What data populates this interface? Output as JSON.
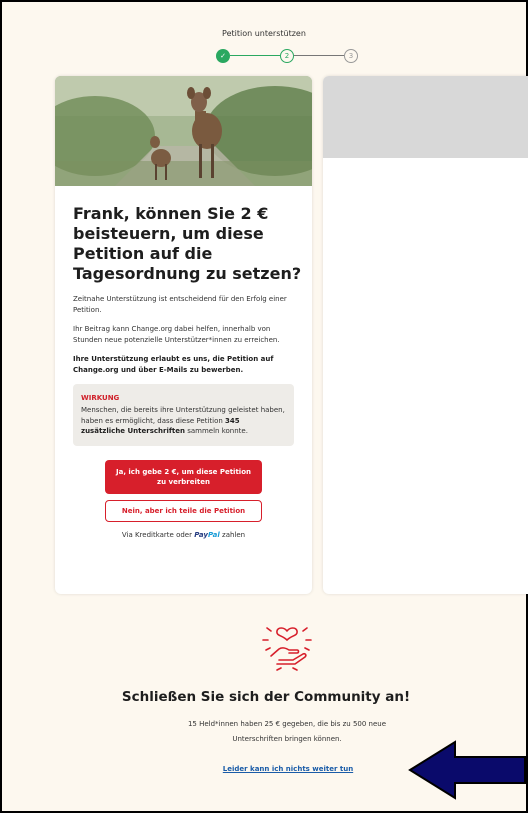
{
  "header": {
    "title": "Petition unterstützen",
    "steps": [
      {
        "label": "✓",
        "state": "done"
      },
      {
        "label": "2",
        "state": "current"
      },
      {
        "label": "3",
        "state": "upcoming"
      }
    ]
  },
  "donation_card": {
    "title": "Frank, können Sie 2 € beisteuern, um diese Petition auf die Tagesordnung zu setzen?",
    "paragraph1": "Zeitnahe Unterstützung ist entscheidend für den Erfolg einer Petition.",
    "paragraph2": "Ihr Beitrag kann Change.org dabei helfen, innerhalb von Stunden neue potenzielle Unterstützer*innen zu erreichen.",
    "paragraph3": "Ihre Unterstützung erlaubt es uns, die Petition auf Change.org und über E-Mails zu bewerben.",
    "impact": {
      "title": "WIRKUNG",
      "text_before": "Menschen, die bereits ihre Unterstützung geleistet haben, haben es ermöglicht, dass diese Petition ",
      "text_bold": "345 zusätzliche Unterschriften",
      "text_after": " sammeln konnte."
    },
    "primary_button": "Ja, ich gebe 2 €, um diese Petition zu verbreiten",
    "secondary_button": "Nein, aber ich teile die Petition",
    "payment_prefix": "Via Kreditkarte oder ",
    "paypal_pay": "Pay",
    "paypal_pal": "Pal",
    "payment_suffix": " zahlen"
  },
  "community": {
    "title": "Schließen Sie sich der Community an!",
    "text": "15 Held*innen haben 25 € gegeben, die bis zu 500 neue Unterschriften bringen können.",
    "link": "Leider kann ich nichts weiter tun"
  },
  "colors": {
    "background": "#fdf8ef",
    "brand_red": "#d71f2b",
    "progress_green": "#2aa860",
    "link_blue": "#1a5ca8",
    "annotation_arrow": "#0a0a6b"
  }
}
